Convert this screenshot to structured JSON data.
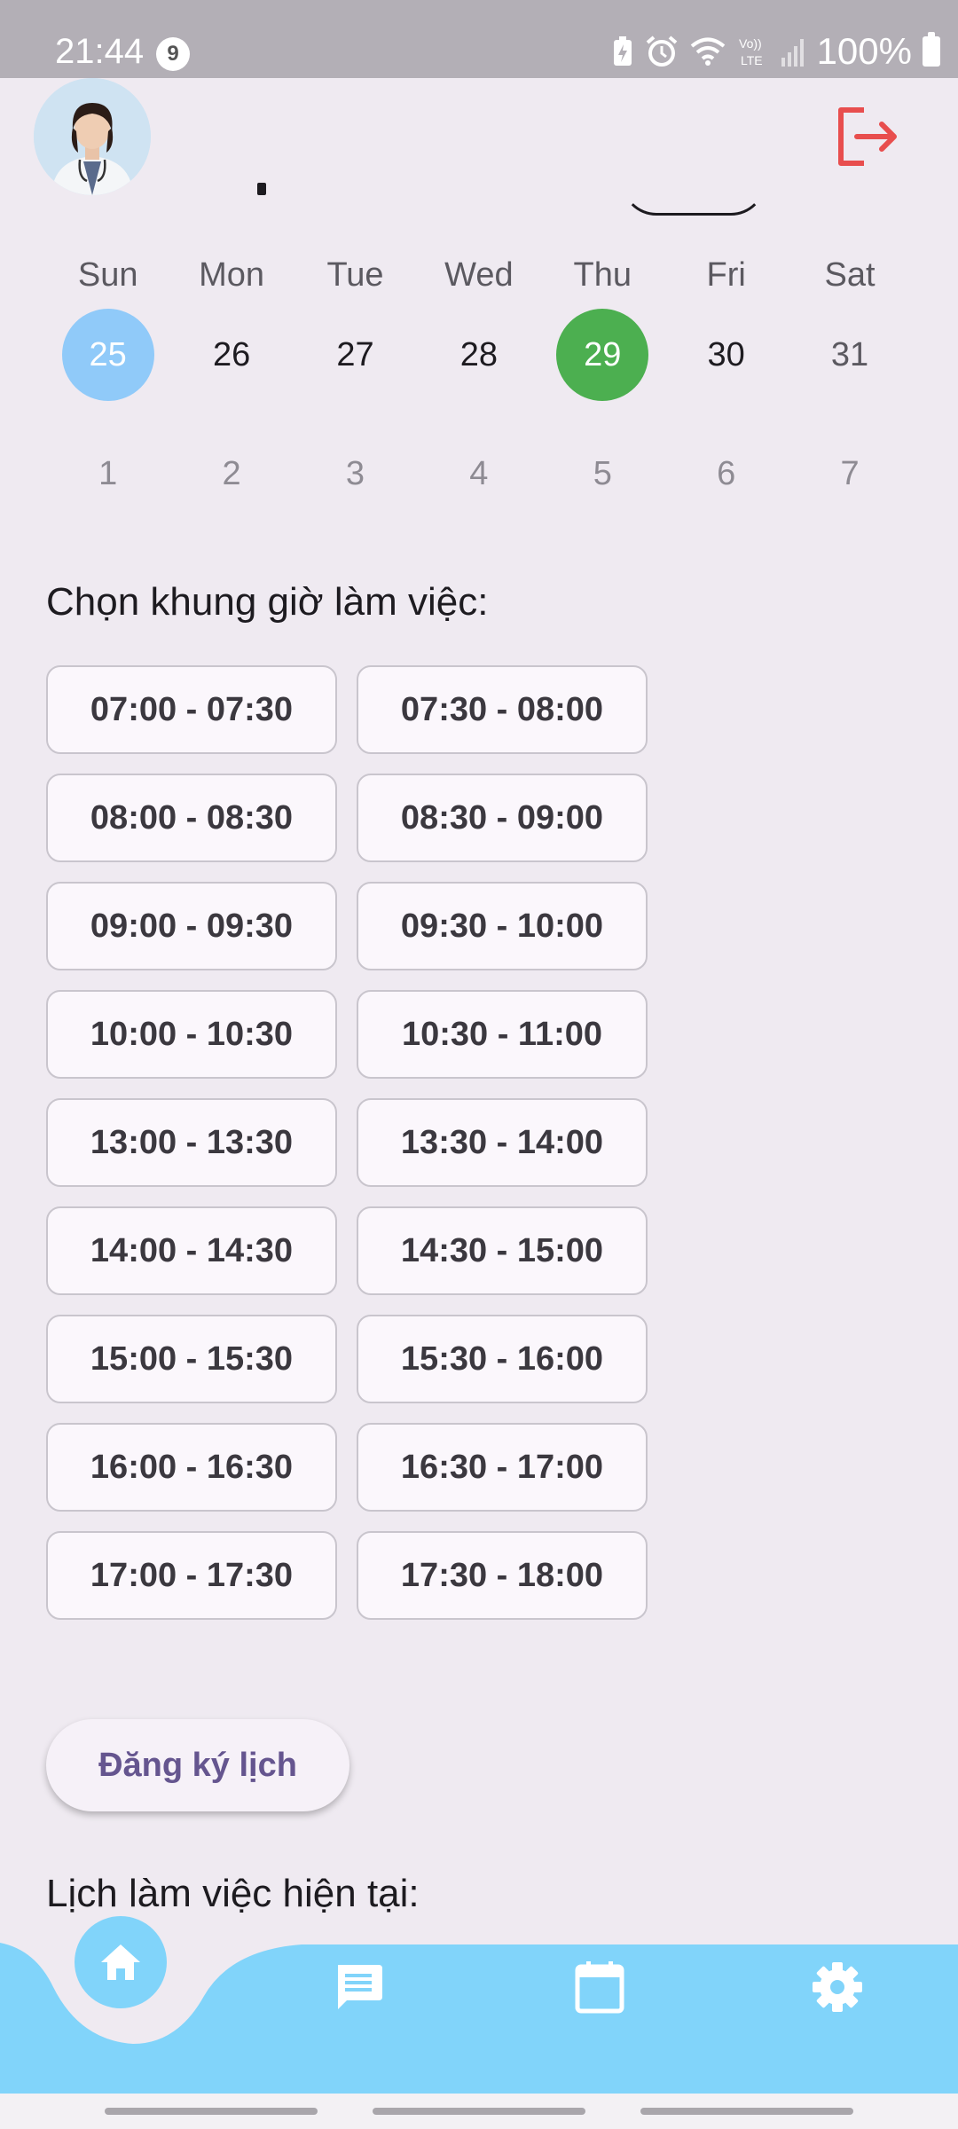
{
  "status_bar": {
    "time": "21:44",
    "notification_count": "9",
    "battery": "100%"
  },
  "header": {
    "avatar_alt": "doctor avatar",
    "logout_icon": "logout-icon",
    "accent_color": "#e53935"
  },
  "calendar": {
    "weekdays": [
      "Sun",
      "Mon",
      "Tue",
      "Wed",
      "Thu",
      "Fri",
      "Sat"
    ],
    "week1": [
      "25",
      "26",
      "27",
      "28",
      "29",
      "30",
      "31"
    ],
    "week2": [
      "1",
      "2",
      "3",
      "4",
      "5",
      "6",
      "7"
    ],
    "today": "25",
    "selected": "29",
    "today_color": "#90caf9",
    "selected_color": "#4caf50"
  },
  "slot_section": {
    "title": "Chọn khung giờ làm việc:",
    "slots": [
      "07:00 - 07:30",
      "07:30 - 08:00",
      "08:00 - 08:30",
      "08:30 - 09:00",
      "09:00 - 09:30",
      "09:30 - 10:00",
      "10:00 - 10:30",
      "10:30 - 11:00",
      "13:00 - 13:30",
      "13:30 - 14:00",
      "14:00 - 14:30",
      "14:30 - 15:00",
      "15:00 - 15:30",
      "15:30 - 16:00",
      "16:00 - 16:30",
      "16:30 - 17:00",
      "17:00 - 17:30",
      "17:30 - 18:00"
    ]
  },
  "register_button": "Đăng ký lịch",
  "current_schedule_title": "Lịch làm việc hiện tại:",
  "bottom_nav": {
    "color": "#81d4fa",
    "items": [
      "home-icon",
      "chat-icon",
      "calendar-icon",
      "settings-icon"
    ],
    "active": "home-icon"
  }
}
